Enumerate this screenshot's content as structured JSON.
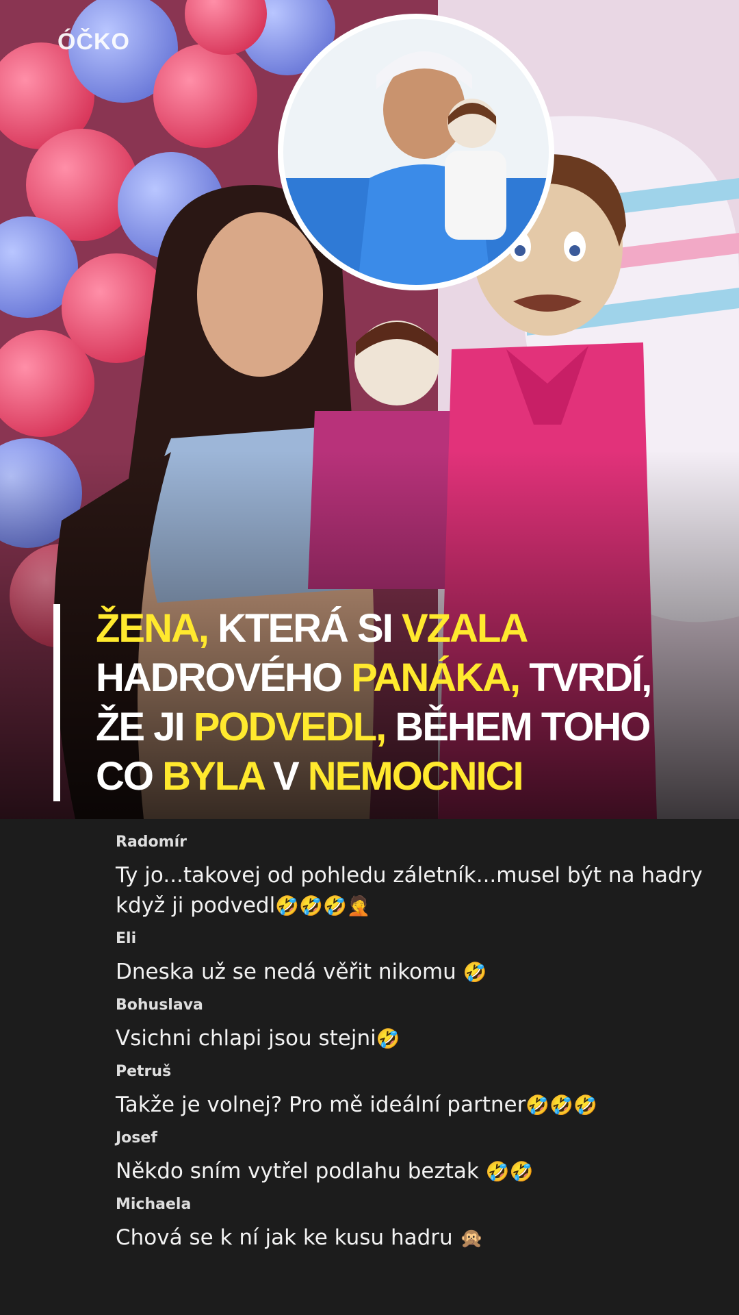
{
  "brand": {
    "logo": "ÓČKO"
  },
  "headline": {
    "parts": [
      {
        "text": "Žena, ",
        "hl": true
      },
      {
        "text": "která si ",
        "hl": false
      },
      {
        "text": "vzala",
        "hl": true
      },
      {
        "br": true
      },
      {
        "text": "hadrového ",
        "hl": false
      },
      {
        "text": "panáka,",
        "hl": true
      },
      {
        "text": " tvrdí,",
        "hl": false
      },
      {
        "br": true
      },
      {
        "text": "že ji ",
        "hl": false
      },
      {
        "text": "podvedl,",
        "hl": true
      },
      {
        "text": " během toho",
        "hl": false
      },
      {
        "br": true
      },
      {
        "text": "co ",
        "hl": false
      },
      {
        "text": "byla",
        "hl": true
      },
      {
        "text": " v ",
        "hl": false
      },
      {
        "text": "nemocnici",
        "hl": true
      }
    ]
  },
  "comments": [
    {
      "author": "Radomír",
      "text": "Ty jo...takovej od pohledu záletník...musel být na hadry když ji podvedl",
      "emoji": "🤣🤣🤣🤦"
    },
    {
      "author": "Eli",
      "text": "Dneska už se nedá věřit nikomu ",
      "emoji": "🤣"
    },
    {
      "author": "Bohuslava",
      "text": "Vsichni chlapi jsou stejni",
      "emoji": "🤣"
    },
    {
      "author": "Petruš",
      "text": "Takže je volnej? Pro mě ideální partner",
      "emoji": "🤣🤣🤣"
    },
    {
      "author": "Josef",
      "text": "Někdo sním vytřel podlahu beztak ",
      "emoji": "🤣🤣"
    },
    {
      "author": "Michaela",
      "text": "Chová se k ní jak ke kusu hadru ",
      "emoji": "🙊"
    }
  ],
  "colors": {
    "highlight": "#ffe92e",
    "background": "#1c1c1c"
  }
}
